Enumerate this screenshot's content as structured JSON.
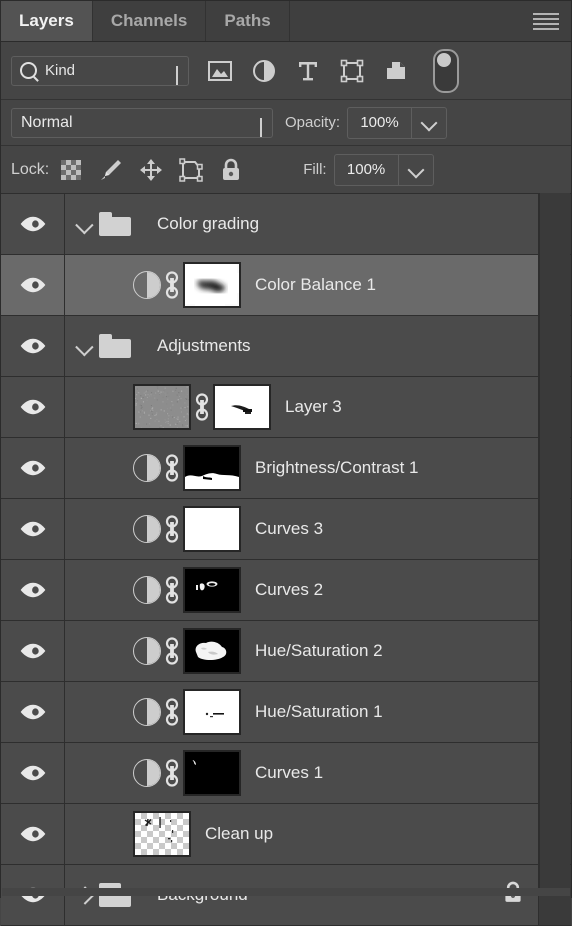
{
  "panel": {
    "tabs": [
      {
        "label": "Layers",
        "active": true
      },
      {
        "label": "Channels",
        "active": false
      },
      {
        "label": "Paths",
        "active": false
      }
    ],
    "menu_icon": "hamburger-menu-icon"
  },
  "filter": {
    "kind_label": "Kind",
    "search_icon": "search-icon",
    "chevron_icon": "chevron-down-icon",
    "type_filters": [
      {
        "name": "pixel-layer-filter-icon",
        "title": "Filter for pixel layers"
      },
      {
        "name": "adjustment-layer-filter-icon",
        "title": "Filter for adjustment layers"
      },
      {
        "name": "type-layer-filter-icon",
        "title": "Filter for type layers"
      },
      {
        "name": "shape-layer-filter-icon",
        "title": "Filter for shape layers"
      },
      {
        "name": "smart-object-filter-icon",
        "title": "Filter for smart objects"
      }
    ],
    "toggle": {
      "name": "filter-enable-toggle",
      "state": "off"
    }
  },
  "blend": {
    "mode": "Normal",
    "opacity_label": "Opacity:",
    "opacity_value": "100%",
    "fill_label": "Fill:",
    "fill_value": "100%"
  },
  "lock": {
    "label": "Lock:",
    "items": [
      {
        "name": "lock-transparent-pixels-icon"
      },
      {
        "name": "lock-image-pixels-icon"
      },
      {
        "name": "lock-position-icon"
      },
      {
        "name": "lock-artboard-nesting-icon"
      },
      {
        "name": "lock-all-icon"
      }
    ]
  },
  "layers": [
    {
      "name": "Color grading",
      "kind": "group",
      "expanded": true,
      "indent": 0,
      "visible": true,
      "selected": false,
      "has_link": false,
      "locked": false
    },
    {
      "name": "Color Balance 1",
      "kind": "adjustment",
      "indent": 1,
      "visible": true,
      "selected": true,
      "has_link": true,
      "mask": "blurred-dark-blob-on-white",
      "mask_selected": true,
      "locked": false
    },
    {
      "name": "Adjustments",
      "kind": "group",
      "expanded": true,
      "indent": 0,
      "visible": true,
      "selected": false,
      "has_link": false,
      "locked": false
    },
    {
      "name": "Layer 3",
      "kind": "pixel",
      "indent": 1,
      "visible": true,
      "selected": false,
      "has_link": true,
      "thumb": "gray-noise",
      "mask": "white-with-dark-streak",
      "locked": false
    },
    {
      "name": "Brightness/Contrast 1",
      "kind": "adjustment",
      "indent": 1,
      "visible": true,
      "selected": false,
      "has_link": true,
      "mask": "black-top-white-bottom",
      "locked": false
    },
    {
      "name": "Curves 3",
      "kind": "adjustment",
      "indent": 1,
      "visible": true,
      "selected": false,
      "has_link": true,
      "mask": "all-white",
      "locked": false
    },
    {
      "name": "Curves 2",
      "kind": "adjustment",
      "indent": 1,
      "visible": true,
      "selected": false,
      "has_link": true,
      "mask": "black-with-small-white-marks",
      "locked": false
    },
    {
      "name": "Hue/Saturation 2",
      "kind": "adjustment",
      "indent": 1,
      "visible": true,
      "selected": false,
      "has_link": true,
      "mask": "black-with-white-blob",
      "locked": false
    },
    {
      "name": "Hue/Saturation 1",
      "kind": "adjustment",
      "indent": 1,
      "visible": true,
      "selected": false,
      "has_link": true,
      "mask": "white-with-small-dark-marks",
      "locked": false
    },
    {
      "name": "Curves 1",
      "kind": "adjustment",
      "indent": 1,
      "visible": true,
      "selected": false,
      "has_link": true,
      "mask": "black-with-tiny-white-mark",
      "locked": false
    },
    {
      "name": "Clean up",
      "kind": "pixel",
      "indent": 1,
      "visible": true,
      "selected": false,
      "has_link": false,
      "thumb": "transparent-checker-with-marks",
      "locked": false
    },
    {
      "name": "Background",
      "kind": "group",
      "expanded": false,
      "indent": 0,
      "visible": true,
      "selected": false,
      "has_link": false,
      "locked": true
    }
  ],
  "colors": {
    "panel_bg": "#454545",
    "row_bg": "#4b4b4b",
    "row_selected_bg": "#6a6a6a",
    "tab_active_bg": "#535353",
    "text": "#e9e9e9",
    "muted_text": "#a8a8a8",
    "divider": "#2e2e2e"
  }
}
